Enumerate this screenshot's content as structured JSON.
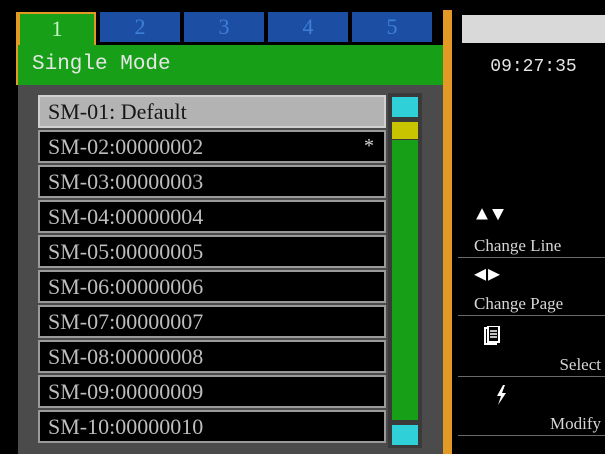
{
  "tabs": [
    {
      "label": "1",
      "active": true
    },
    {
      "label": "2",
      "active": false
    },
    {
      "label": "3",
      "active": false
    },
    {
      "label": "4",
      "active": false
    },
    {
      "label": "5",
      "active": false
    }
  ],
  "mode_title": "Single Mode",
  "list": {
    "items": [
      {
        "label": "SM-01: Default",
        "marker": "",
        "selected": true
      },
      {
        "label": "SM-02:00000002",
        "marker": "*",
        "selected": false
      },
      {
        "label": "SM-03:00000003",
        "marker": "",
        "selected": false
      },
      {
        "label": "SM-04:00000004",
        "marker": "",
        "selected": false
      },
      {
        "label": "SM-05:00000005",
        "marker": "",
        "selected": false
      },
      {
        "label": "SM-06:00000006",
        "marker": "",
        "selected": false
      },
      {
        "label": "SM-07:00000007",
        "marker": "",
        "selected": false
      },
      {
        "label": "SM-08:00000008",
        "marker": "",
        "selected": false
      },
      {
        "label": "SM-09:00000009",
        "marker": "",
        "selected": false
      },
      {
        "label": "SM-10:00000010",
        "marker": "",
        "selected": false
      }
    ]
  },
  "status": {
    "time": "09:27:35"
  },
  "hints": {
    "change_line": {
      "icon": "up-down-arrows-icon",
      "glyph": "▲▼",
      "label": "Change Line"
    },
    "change_page": {
      "icon": "left-right-arrows-icon",
      "glyph": "◀▶",
      "label": "Change Page"
    },
    "select": {
      "icon": "clipboard-icon",
      "label": "Select"
    },
    "modify": {
      "icon": "lightning-icon",
      "glyph": "ϟ",
      "label": "Modify"
    }
  }
}
